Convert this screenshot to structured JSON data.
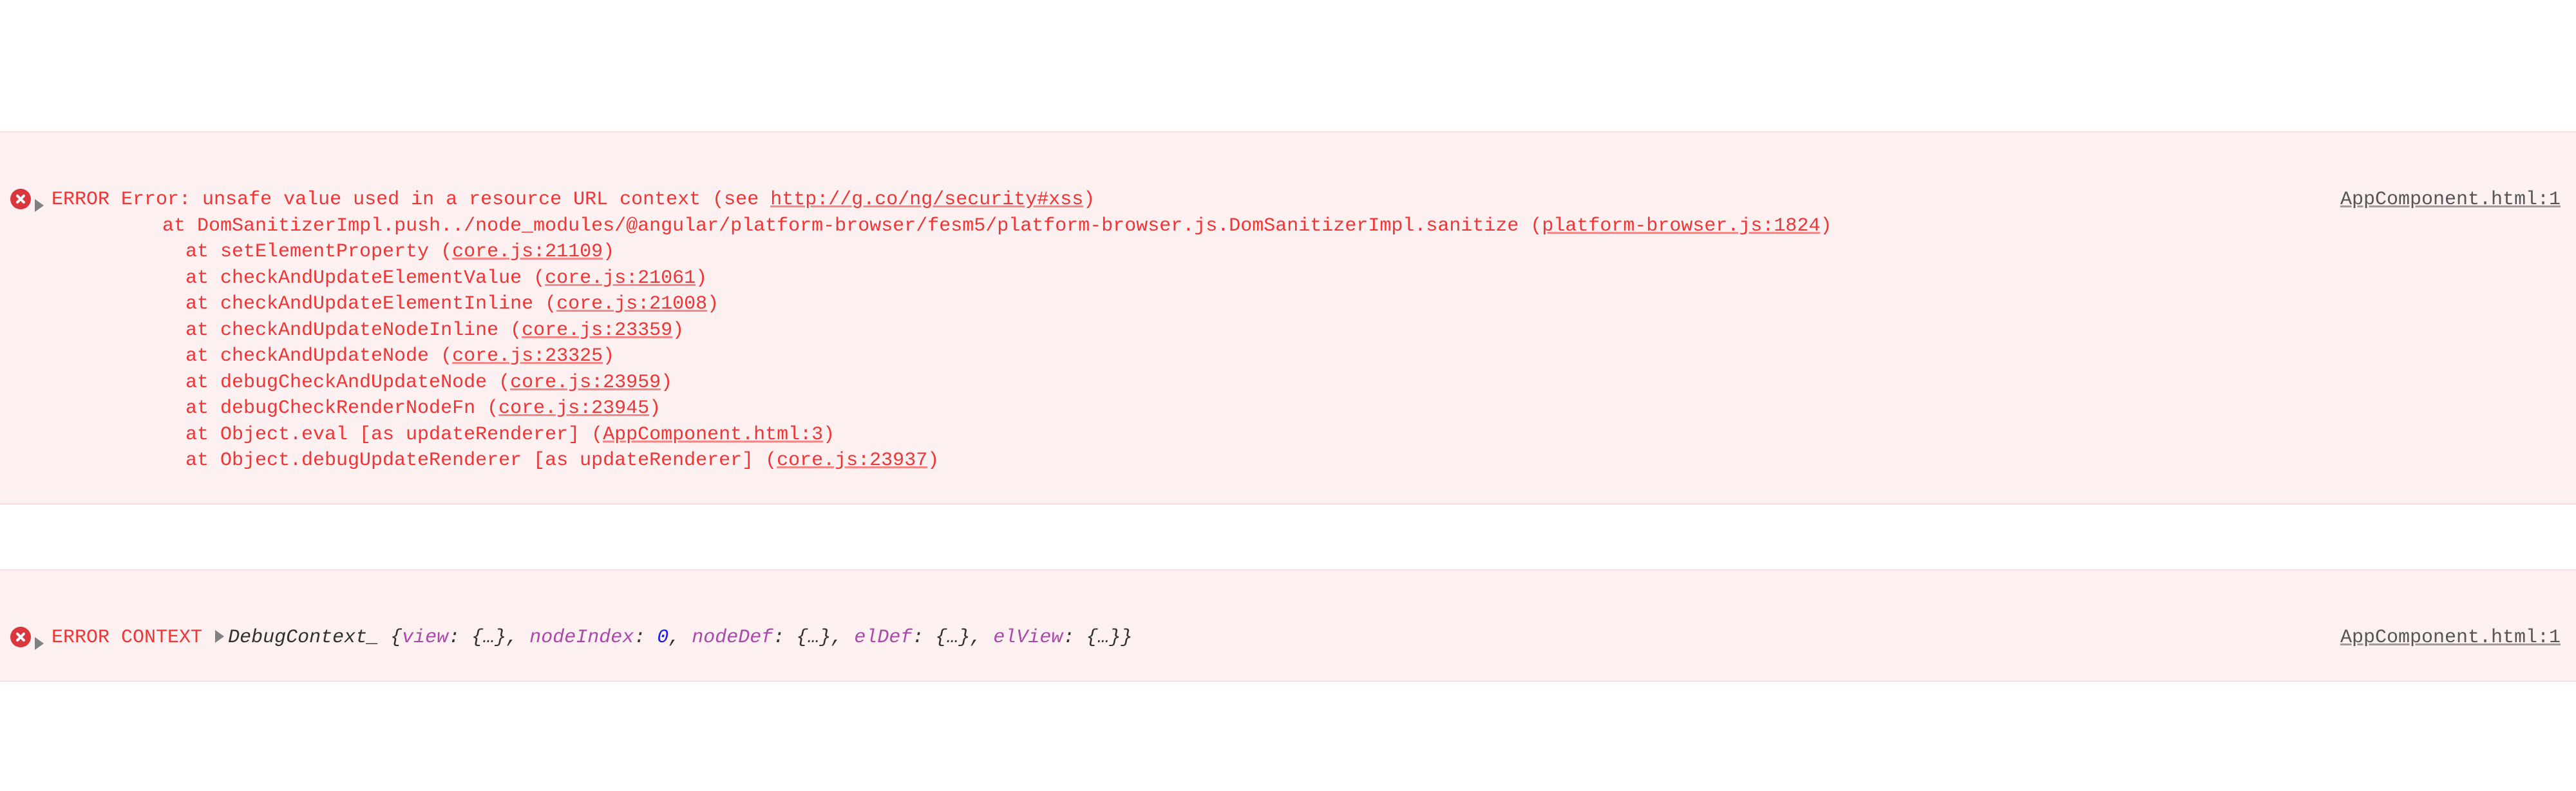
{
  "entries": [
    {
      "source": "AppComponent.html:1",
      "prefix": "ERROR",
      "message_pre": "Error: unsafe value used in a resource URL context (see ",
      "message_link": "http://g.co/ng/security#xss",
      "message_post": ")",
      "stack_first_a": "    at DomSanitizerImpl.push../node_modules/@angular/platform-browser/fesm5/platform-browser.js.DomSanitizerImpl.sanitize (",
      "stack_first_link": "platform-browser.js:1824",
      "stack_first_b": ")",
      "stack": [
        {
          "pre": "at setElementProperty (",
          "link": "core.js:21109",
          "post": ")"
        },
        {
          "pre": "at checkAndUpdateElementValue (",
          "link": "core.js:21061",
          "post": ")"
        },
        {
          "pre": "at checkAndUpdateElementInline (",
          "link": "core.js:21008",
          "post": ")"
        },
        {
          "pre": "at checkAndUpdateNodeInline (",
          "link": "core.js:23359",
          "post": ")"
        },
        {
          "pre": "at checkAndUpdateNode (",
          "link": "core.js:23325",
          "post": ")"
        },
        {
          "pre": "at debugCheckAndUpdateNode (",
          "link": "core.js:23959",
          "post": ")"
        },
        {
          "pre": "at debugCheckRenderNodeFn (",
          "link": "core.js:23945",
          "post": ")"
        },
        {
          "pre": "at Object.eval [as updateRenderer] (",
          "link": "AppComponent.html:3",
          "post": ")"
        },
        {
          "pre": "at Object.debugUpdateRenderer [as updateRenderer] (",
          "link": "core.js:23937",
          "post": ")"
        }
      ]
    },
    {
      "source": "AppComponent.html:1",
      "prefix": "ERROR CONTEXT",
      "obj_name": "DebugContext_",
      "props": [
        {
          "k": "view",
          "v": "{…}"
        },
        {
          "k": "nodeIndex",
          "v": "0",
          "num": true
        },
        {
          "k": "nodeDef",
          "v": "{…}"
        },
        {
          "k": "elDef",
          "v": "{…}"
        },
        {
          "k": "elView",
          "v": "{…}"
        }
      ]
    }
  ]
}
